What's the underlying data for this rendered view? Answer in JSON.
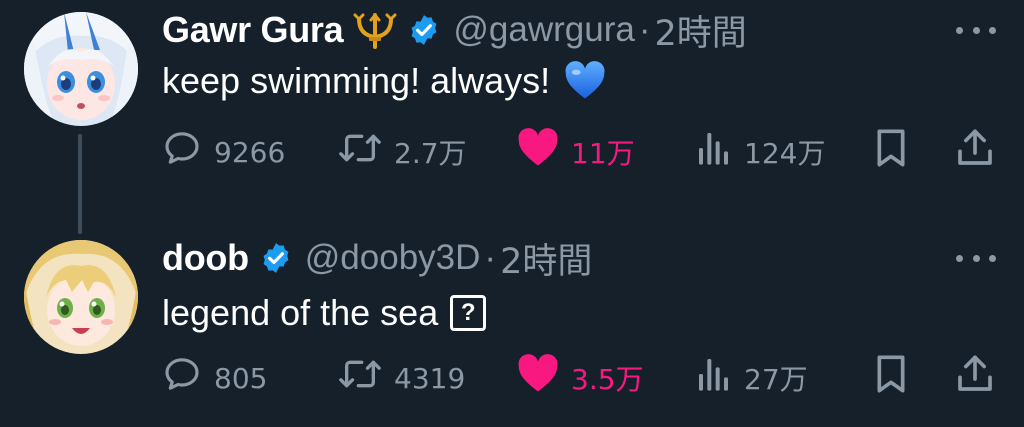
{
  "tweets": [
    {
      "name": "Gawr Gura",
      "name_emoji": "trident-emoji",
      "verified": true,
      "handle": "@gawrgura",
      "separator": "·",
      "time": "2時間",
      "text": "keep swimming! always!",
      "text_emoji": "blue-heart-emoji",
      "avatar": "shark-girl-avatar",
      "stats": {
        "replies": "9266",
        "retweets": "2.7万",
        "likes": "11万",
        "views": "124万"
      },
      "liked": true
    },
    {
      "name": "doob",
      "verified": true,
      "handle": "@dooby3D",
      "separator": "·",
      "time": "2時間",
      "text": "legend of the sea",
      "text_glyph": "?",
      "avatar": "blonde-girl-avatar",
      "stats": {
        "replies": "805",
        "retweets": "4319",
        "likes": "3.5万",
        "views": "27万"
      },
      "liked": true
    }
  ],
  "colors": {
    "background": "#15202b",
    "muted": "#8b98a5",
    "like": "#f91880",
    "verified": "#1d9bf0",
    "thread_line": "#3d4d5c"
  }
}
